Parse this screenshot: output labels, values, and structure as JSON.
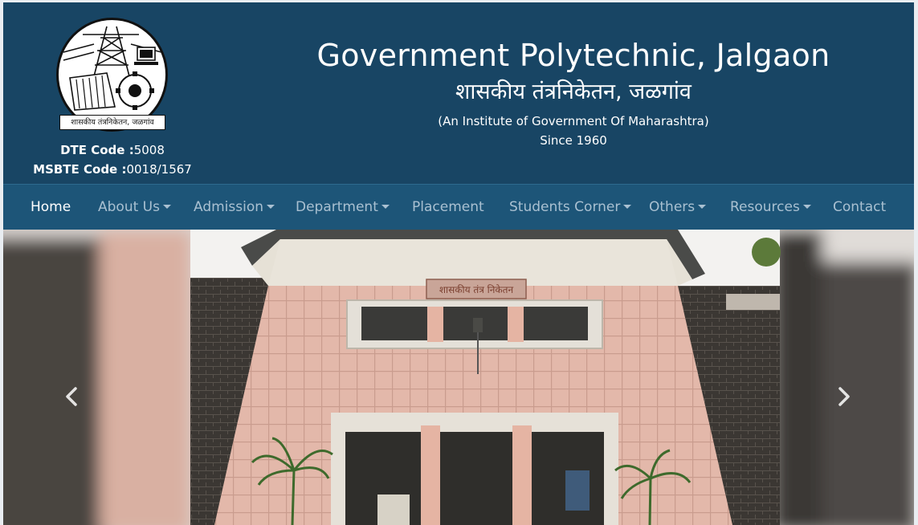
{
  "header": {
    "logo_caption": "शासकीय तंत्रनिकेतन, जळगांव",
    "dte_label": "DTE Code :",
    "dte_value": "5008",
    "msbte_label": "MSBTE Code :",
    "msbte_value": "0018/1567",
    "title_en": "Government Polytechnic, Jalgaon",
    "title_mr": "शासकीय तंत्रनिकेतन, जळगांव",
    "subtitle": "(An Institute of Government Of Maharashtra)",
    "since": "Since 1960"
  },
  "nav": {
    "items": [
      {
        "label": "Home",
        "dropdown": false,
        "active": true
      },
      {
        "label": "About Us",
        "dropdown": true,
        "active": false
      },
      {
        "label": "Admission",
        "dropdown": true,
        "active": false
      },
      {
        "label": "Department",
        "dropdown": true,
        "active": false
      },
      {
        "label": "Placement",
        "dropdown": false,
        "active": false
      },
      {
        "label": "Students Corner",
        "dropdown": true,
        "active": false
      },
      {
        "label": "Others",
        "dropdown": true,
        "active": false
      },
      {
        "label": "Resources",
        "dropdown": true,
        "active": false
      },
      {
        "label": "Contact",
        "dropdown": false,
        "active": false
      }
    ]
  },
  "carousel": {
    "building_sign": "शासकीय तंत्र निकेतन",
    "prev_icon": "chevron-left-icon",
    "next_icon": "chevron-right-icon"
  },
  "colors": {
    "header_bg": "#184564",
    "navbar_bg": "#1d5578",
    "nav_text": "#a9c0d1",
    "nav_active": "#ffffff"
  }
}
